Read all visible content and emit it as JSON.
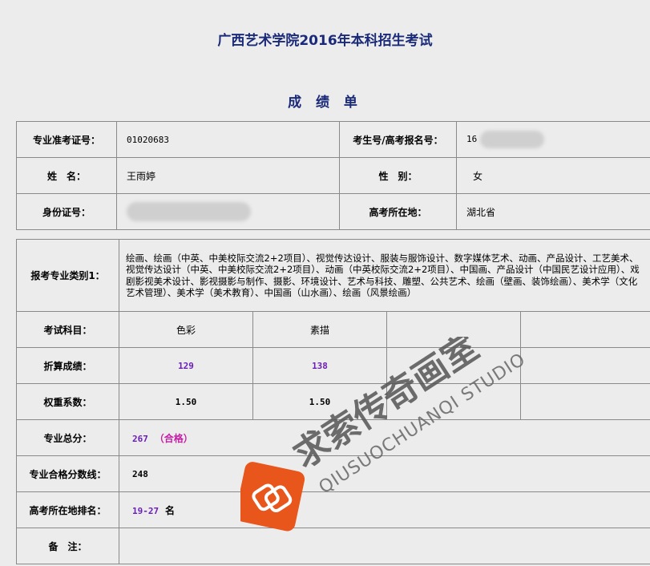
{
  "header": {
    "title": "广西艺术学院2016年本科招生考试",
    "subtitle": "成 绩 单"
  },
  "info": {
    "ticket_label": "专业准考证号：",
    "ticket_value": "01020683",
    "exam_no_label": "考生号/高考报名号：",
    "exam_no_prefix": "16",
    "name_label": "姓　名：",
    "name_value": "王雨婷",
    "gender_label": "性　别：",
    "gender_value": "女",
    "id_label": "身份证号：",
    "province_label": "高考所在地：",
    "province_value": "湖北省"
  },
  "scores": {
    "majors_label": "报考专业类别1：",
    "majors_value": "绘画、绘画（中英、中美校际交流2+2项目）、视觉传达设计、服装与服饰设计、数字媒体艺术、动画、产品设计、工艺美术、视觉传达设计（中英、中美校际交流2+2项目）、动画（中英校际交流2+2项目）、中国画、产品设计（中国民艺设计应用）、戏剧影视美术设计、影视摄影与制作、摄影、环境设计、艺术与科技、雕塑、公共艺术、绘画（壁画、装饰绘画）、美术学（文化艺术管理）、美术学（美术教育）、中国画（山水画）、绘画（风景绘画）",
    "subjects_label": "考试科目：",
    "subjects": [
      "色彩",
      "素描",
      "",
      ""
    ],
    "converted_label": "折算成绩：",
    "converted": [
      "129",
      "138",
      "",
      ""
    ],
    "weights_label": "权重系数：",
    "weights": [
      "1.50",
      "1.50",
      "",
      ""
    ],
    "total_label": "专业总分：",
    "total_value": "267",
    "total_status": "（合格）",
    "pass_label": "专业合格分数线：",
    "pass_value": "248",
    "rank_label": "高考所在地排名：",
    "rank_value": "19-27",
    "rank_unit": "名",
    "remark_label": "备　注：",
    "remark_value": ""
  },
  "watermark": {
    "brand_cn": "求索传奇画室",
    "brand_en": "QIUSUOCHUANQI STUDIO",
    "logo_color": "#e8561c"
  }
}
